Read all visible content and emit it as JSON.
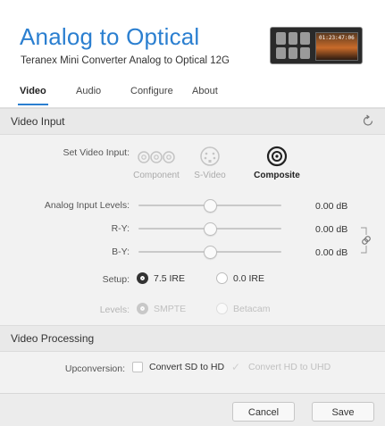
{
  "header": {
    "title": "Analog to Optical",
    "subtitle": "Teranex Mini Converter Analog to Optical 12G",
    "device_timecode": "01:23:47:06"
  },
  "tabs": [
    {
      "label": "Video",
      "active": true
    },
    {
      "label": "Audio",
      "active": false
    },
    {
      "label": "Configure",
      "active": false
    },
    {
      "label": "About",
      "active": false
    }
  ],
  "video_input": {
    "section_label": "Video Input",
    "set_input_label": "Set Video Input:",
    "options": [
      {
        "label": "Component",
        "selected": false
      },
      {
        "label": "S-Video",
        "selected": false
      },
      {
        "label": "Composite",
        "selected": true
      }
    ],
    "levels_label": "Analog Input Levels:",
    "channels": [
      {
        "label": "Analog Input Levels:",
        "value": "0.00 dB",
        "level": 0.5
      },
      {
        "label": "R-Y:",
        "value": "0.00 dB",
        "level": 0.5
      },
      {
        "label": "B-Y:",
        "value": "0.00 dB",
        "level": 0.5
      }
    ],
    "setup_label": "Setup:",
    "setup_options": [
      {
        "label": "7.5 IRE",
        "selected": true
      },
      {
        "label": "0.0 IRE",
        "selected": false
      }
    ],
    "levels_mode_label": "Levels:",
    "levels_options": [
      {
        "label": "SMPTE",
        "selected": true
      },
      {
        "label": "Betacam",
        "selected": false
      }
    ]
  },
  "video_processing": {
    "section_label": "Video Processing",
    "upconversion_label": "Upconversion:",
    "options": [
      {
        "label": "Convert SD to HD",
        "checked": false,
        "enabled": true
      },
      {
        "label": "Convert HD to UHD",
        "checked": true,
        "enabled": false
      }
    ]
  },
  "footer": {
    "cancel_label": "Cancel",
    "save_label": "Save"
  },
  "colors": {
    "accent": "#2b7fd0",
    "panel": "#f2f2f2",
    "section_header": "#e9e9e9"
  }
}
